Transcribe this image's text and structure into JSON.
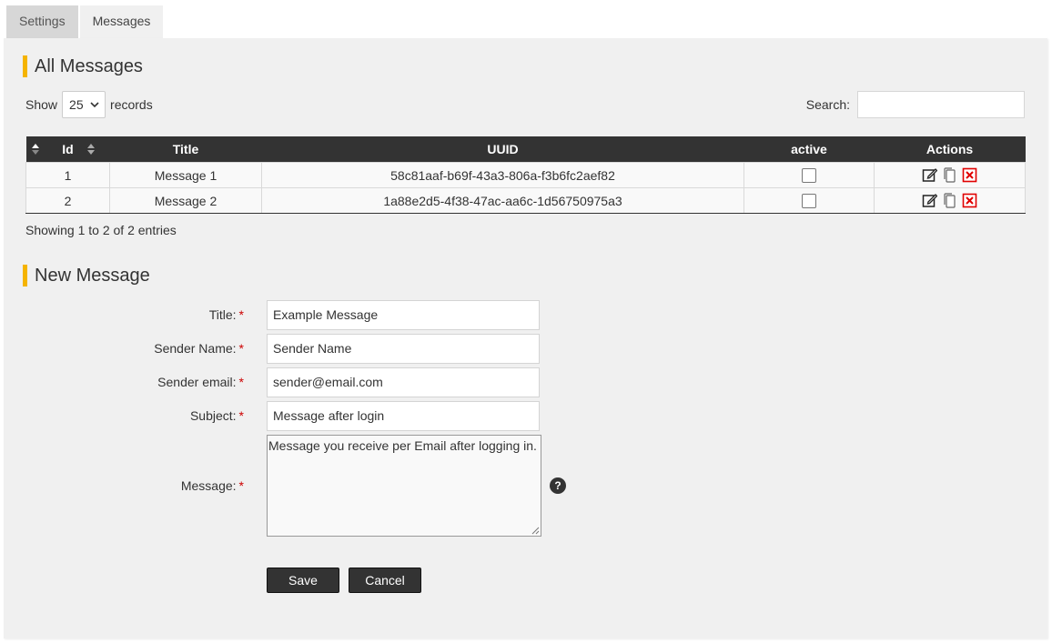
{
  "tabs": [
    {
      "label": "Settings",
      "active": false
    },
    {
      "label": "Messages",
      "active": true
    }
  ],
  "all_messages": {
    "title": "All Messages",
    "show_label": "Show",
    "records_label": "records",
    "page_size": "25",
    "search_label": "Search:",
    "search_value": "",
    "columns": [
      "Id",
      "Title",
      "UUID",
      "active",
      "Actions"
    ],
    "rows": [
      {
        "id": "1",
        "title": "Message 1",
        "uuid": "58c81aaf-b69f-43a3-806a-f3b6fc2aef82",
        "active": false
      },
      {
        "id": "2",
        "title": "Message 2",
        "uuid": "1a88e2d5-4f38-47ac-aa6c-1d56750975a3",
        "active": false
      }
    ],
    "showing_text": "Showing 1 to 2 of 2 entries"
  },
  "new_message": {
    "title": "New Message",
    "required_marker": "*",
    "fields": {
      "title": {
        "label": "Title:",
        "value": "Example Message"
      },
      "sender_name": {
        "label": "Sender Name:",
        "value": "Sender Name"
      },
      "sender_email": {
        "label": "Sender email:",
        "value": "sender@email.com"
      },
      "subject": {
        "label": "Subject:",
        "value": "Message after login"
      },
      "message": {
        "label": "Message:",
        "value": "Message you receive per Email after logging in."
      }
    },
    "help_symbol": "?",
    "save_label": "Save",
    "cancel_label": "Cancel"
  },
  "colors": {
    "accent": "#f5b400",
    "header_dark": "#333333",
    "delete_red": "#e00000",
    "required_red": "#cc0000"
  },
  "icons": {
    "sort": "sort-icon",
    "edit": "edit-icon",
    "copy": "copy-icon",
    "delete": "delete-icon",
    "dropdown": "chevron-down-icon",
    "help": "help-icon"
  }
}
